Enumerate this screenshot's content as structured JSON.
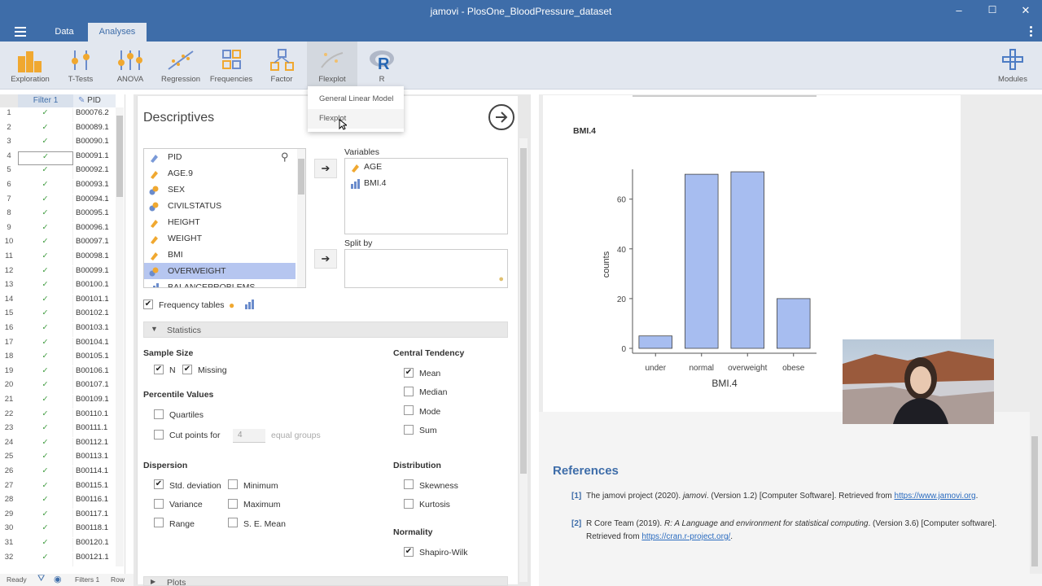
{
  "window": {
    "title": "jamovi - PlosOne_BloodPressure_dataset"
  },
  "menubar": {
    "tabs": [
      "Data",
      "Analyses"
    ]
  },
  "ribbon": {
    "buttons": [
      "Exploration",
      "T-Tests",
      "ANOVA",
      "Regression",
      "Frequencies",
      "Factor",
      "Flexplot",
      "R",
      "Modules"
    ]
  },
  "dropdown": {
    "items": [
      "General Linear Model",
      "Flexplot"
    ]
  },
  "datagrid": {
    "headers": [
      "Filter 1",
      "PID"
    ],
    "rows": [
      [
        "1",
        "✓",
        "B00076.2"
      ],
      [
        "2",
        "✓",
        "B00089.1"
      ],
      [
        "3",
        "✓",
        "B00090.1"
      ],
      [
        "4",
        "✓",
        "B00091.1"
      ],
      [
        "5",
        "✓",
        "B00092.1"
      ],
      [
        "6",
        "✓",
        "B00093.1"
      ],
      [
        "7",
        "✓",
        "B00094.1"
      ],
      [
        "8",
        "✓",
        "B00095.1"
      ],
      [
        "9",
        "✓",
        "B00096.1"
      ],
      [
        "10",
        "✓",
        "B00097.1"
      ],
      [
        "11",
        "✓",
        "B00098.1"
      ],
      [
        "12",
        "✓",
        "B00099.1"
      ],
      [
        "13",
        "✓",
        "B00100.1"
      ],
      [
        "14",
        "✓",
        "B00101.1"
      ],
      [
        "15",
        "✓",
        "B00102.1"
      ],
      [
        "16",
        "✓",
        "B00103.1"
      ],
      [
        "17",
        "✓",
        "B00104.1"
      ],
      [
        "18",
        "✓",
        "B00105.1"
      ],
      [
        "19",
        "✓",
        "B00106.1"
      ],
      [
        "20",
        "✓",
        "B00107.1"
      ],
      [
        "21",
        "✓",
        "B00109.1"
      ],
      [
        "22",
        "✓",
        "B00110.1"
      ],
      [
        "23",
        "✓",
        "B00111.1"
      ],
      [
        "24",
        "✓",
        "B00112.1"
      ],
      [
        "25",
        "✓",
        "B00113.1"
      ],
      [
        "26",
        "✓",
        "B00114.1"
      ],
      [
        "27",
        "✓",
        "B00115.1"
      ],
      [
        "28",
        "✓",
        "B00116.1"
      ],
      [
        "29",
        "✓",
        "B00117.1"
      ],
      [
        "30",
        "✓",
        "B00118.1"
      ],
      [
        "31",
        "✓",
        "B00120.1"
      ],
      [
        "32",
        "✓",
        "B00121.1"
      ]
    ]
  },
  "status": {
    "ready": "Ready",
    "filters": "Filters 1",
    "row": "Row"
  },
  "analysis": {
    "title": "Descriptives",
    "source_vars": [
      "PID",
      "AGE.9",
      "SEX",
      "CIVILSTATUS",
      "HEIGHT",
      "WEIGHT",
      "BMI",
      "OVERWEIGHT",
      "BALANCEPROBLEMS"
    ],
    "variables_label": "Variables",
    "variables": [
      "AGE",
      "BMI.4"
    ],
    "splitby_label": "Split by",
    "freq_tables": "Frequency tables",
    "statistics_label": "Statistics",
    "sample_size": "Sample Size",
    "n": "N",
    "missing": "Missing",
    "percentile_values": "Percentile Values",
    "quartiles": "Quartiles",
    "cut_points": "Cut points for",
    "cut_value": "4",
    "equal_groups": "equal groups",
    "dispersion": "Dispersion",
    "std_dev": "Std. deviation",
    "minimum": "Minimum",
    "variance": "Variance",
    "maximum": "Maximum",
    "range": "Range",
    "se_mean": "S. E. Mean",
    "central_tendency": "Central Tendency",
    "mean": "Mean",
    "median": "Median",
    "mode": "Mode",
    "sum": "Sum",
    "distribution": "Distribution",
    "skewness": "Skewness",
    "kurtosis": "Kurtosis",
    "normality": "Normality",
    "shapiro": "Shapiro-Wilk",
    "plots": "Plots"
  },
  "results": {
    "plot_title": "BMI.4",
    "references_title": "References",
    "ref1_num": "[1]",
    "ref1_a": "The jamovi project (2020). ",
    "ref1_b": "jamovi",
    "ref1_c": ". (Version 1.2) [Computer Software]. Retrieved from ",
    "ref1_link": "https://www.jamovi.org",
    "ref1_d": ".",
    "ref2_num": "[2]",
    "ref2_a": "R Core Team (2019). ",
    "ref2_b": "R: A Language and environment for statistical computing",
    "ref2_c": ". (Version 3.6) [Computer software].",
    "ref2_d": "Retrieved from ",
    "ref2_link": "https://cran.r-project.org/",
    "ref2_e": "."
  },
  "chart_data": {
    "type": "bar",
    "categories": [
      "under",
      "normal",
      "overweight",
      "obese"
    ],
    "values": [
      5,
      70,
      71,
      20
    ],
    "title": "BMI.4",
    "xlabel": "BMI.4",
    "ylabel": "counts",
    "yticks": [
      "0",
      "20",
      "40",
      "60"
    ],
    "ylim": [
      0,
      72
    ],
    "color": "#a7bdf0"
  },
  "colors": {
    "accent": "#3e6da9",
    "check": "#3d9a3d",
    "link": "#2a6bbf"
  }
}
